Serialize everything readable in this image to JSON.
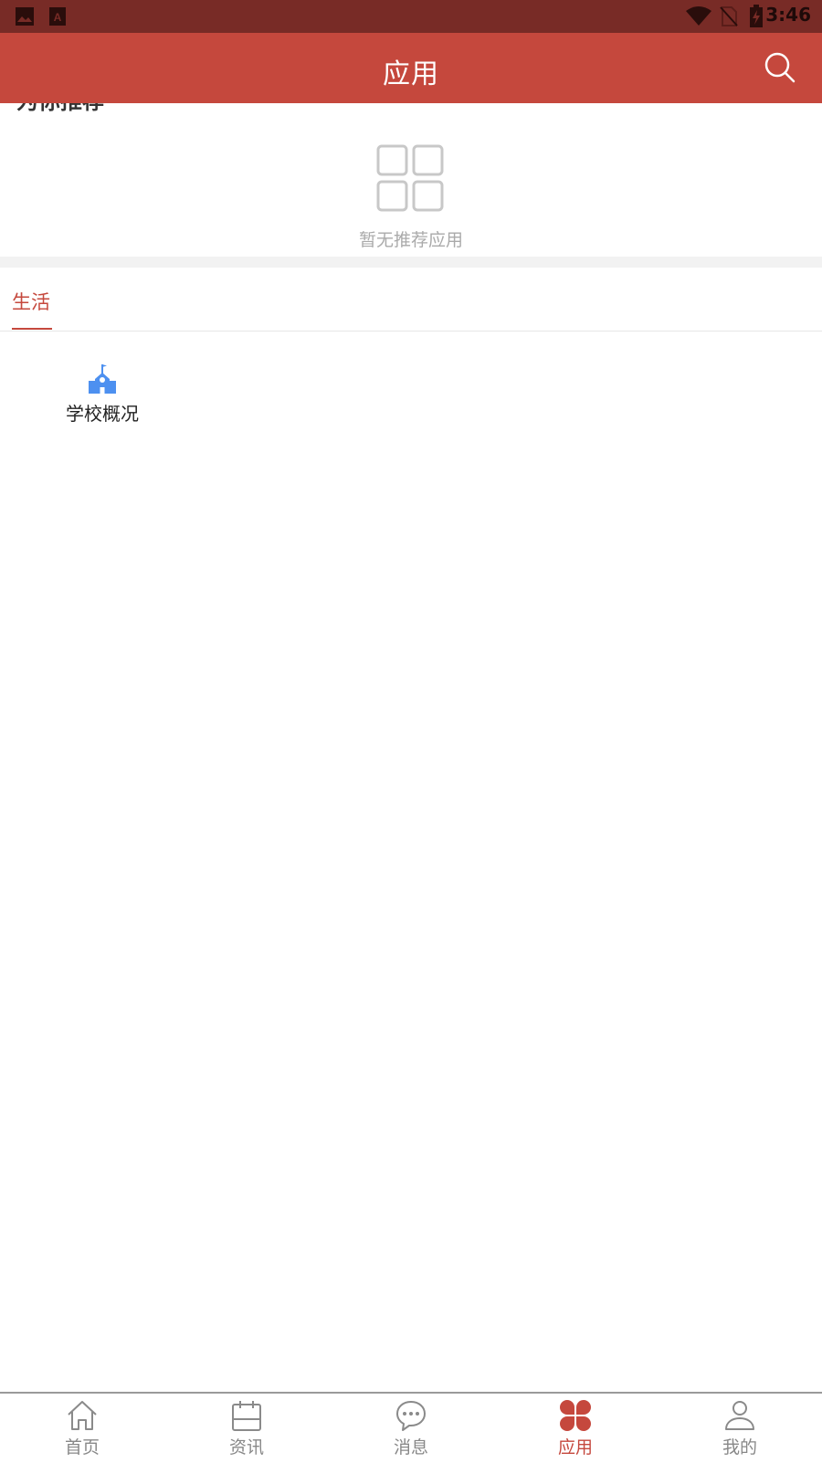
{
  "status_bar": {
    "time": "3:46",
    "icons": [
      "image-icon",
      "text-a-icon",
      "wifi-icon",
      "no-sim-icon",
      "battery-charging-icon"
    ]
  },
  "header": {
    "title": "应用",
    "search_icon": "search-icon"
  },
  "recommend": {
    "title": "为你推荐",
    "empty_icon": "grid-icon",
    "empty_text": "暂无推荐应用"
  },
  "tabs": [
    {
      "label": "生活",
      "active": true
    }
  ],
  "apps": [
    {
      "label": "学校概况",
      "icon": "school-icon"
    }
  ],
  "bottom_nav": [
    {
      "label": "首页",
      "icon": "home-icon",
      "active": false
    },
    {
      "label": "资讯",
      "icon": "calendar-icon",
      "active": false
    },
    {
      "label": "消息",
      "icon": "chat-bubble-icon",
      "active": false
    },
    {
      "label": "应用",
      "icon": "apps-clover-icon",
      "active": true
    },
    {
      "label": "我的",
      "icon": "person-icon",
      "active": false
    }
  ],
  "colors": {
    "status_bar": "#782b26",
    "primary": "#c5483d",
    "inactive": "#888888",
    "app_icon": "#4d90f0"
  }
}
